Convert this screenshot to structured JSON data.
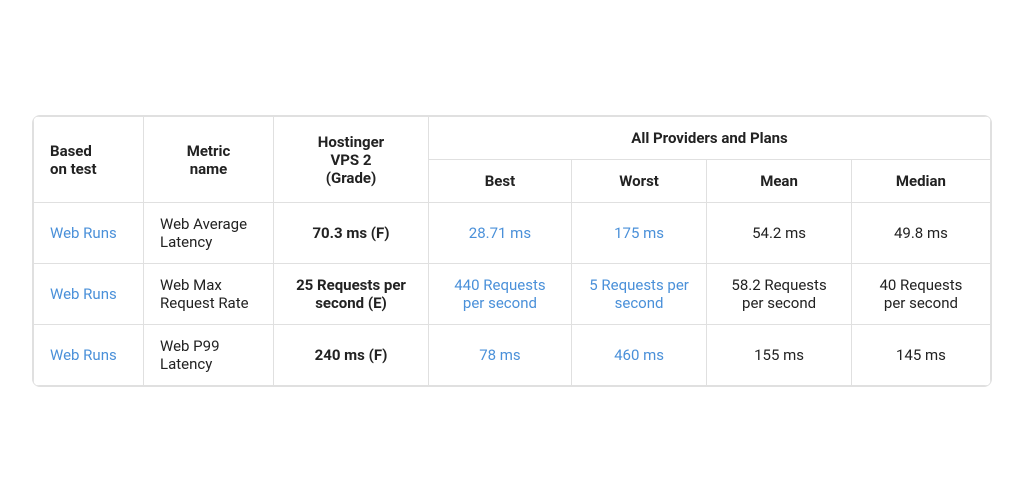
{
  "table": {
    "headers": {
      "col1": "Based\non test",
      "col2": "Metric\nname",
      "col3_line1": "Hostinger",
      "col3_line2": "VPS 2",
      "col3_line3": "(Grade)",
      "col4_group": "All Providers and Plans",
      "col4_best": "Best",
      "col4_worst": "Worst",
      "col4_mean": "Mean",
      "col4_median": "Median"
    },
    "rows": [
      {
        "based_on_test": "Web Runs",
        "metric_name": "Web Average Latency",
        "hostinger_value": "70.3 ms (F)",
        "hostinger_grade": "F",
        "best": "28.71 ms",
        "worst": "175 ms",
        "mean": "54.2 ms",
        "median": "49.8 ms",
        "hostinger_bg": "f"
      },
      {
        "based_on_test": "Web Runs",
        "metric_name": "Web Max Request Rate",
        "hostinger_value": "25 Requests per second (E)",
        "hostinger_grade": "E",
        "best": "440 Requests per second",
        "worst": "5 Requests per second",
        "mean": "58.2 Requests per second",
        "median": "40 Requests per second",
        "hostinger_bg": "e"
      },
      {
        "based_on_test": "Web Runs",
        "metric_name": "Web P99 Latency",
        "hostinger_value": "240 ms (F)",
        "hostinger_grade": "F",
        "best": "78 ms",
        "worst": "460 ms",
        "mean": "155 ms",
        "median": "145 ms",
        "hostinger_bg": "f"
      }
    ]
  }
}
